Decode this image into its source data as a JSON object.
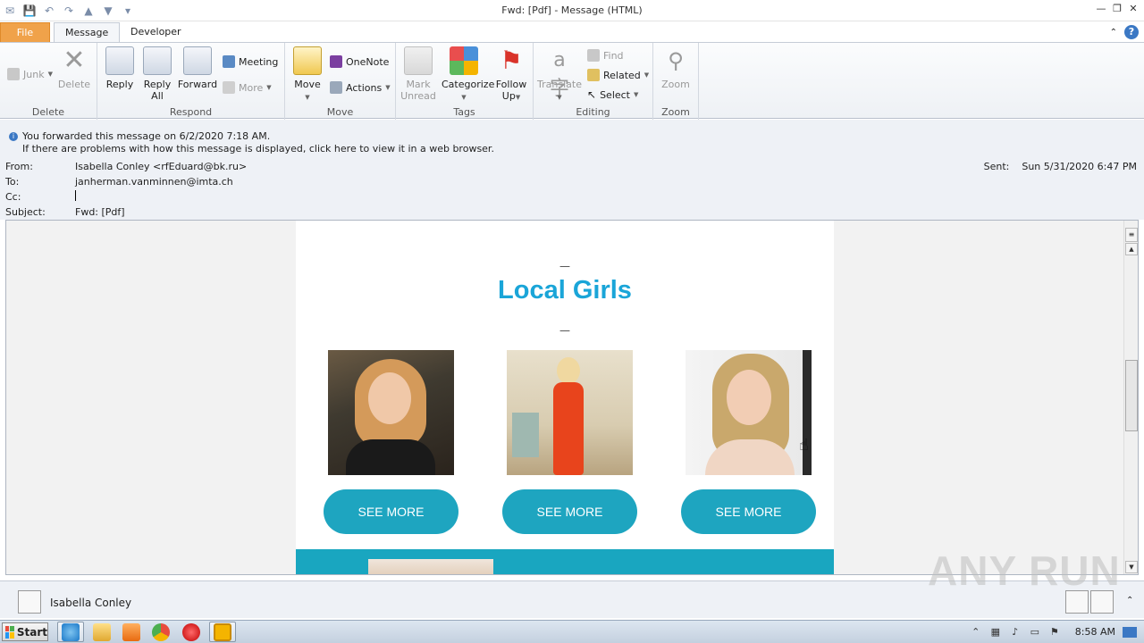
{
  "window": {
    "title": "Fwd: [Pdf]    - Message (HTML)"
  },
  "tabs": {
    "file": "File",
    "message": "Message",
    "developer": "Developer"
  },
  "ribbon": {
    "delete_group": {
      "label": "Delete",
      "junk": "Junk",
      "delete": "Delete"
    },
    "respond_group": {
      "label": "Respond",
      "reply": "Reply",
      "reply_all_1": "Reply",
      "reply_all_2": "All",
      "forward": "Forward",
      "meeting": "Meeting",
      "more": "More"
    },
    "move_group": {
      "label": "Move",
      "move": "Move",
      "onenote": "OneNote",
      "actions": "Actions"
    },
    "tags_group": {
      "label": "Tags",
      "mark_unread_1": "Mark",
      "mark_unread_2": "Unread",
      "categorize": "Categorize",
      "follow_up_1": "Follow",
      "follow_up_2": "Up"
    },
    "editing_group": {
      "label": "Editing",
      "translate": "Translate",
      "find": "Find",
      "related": "Related",
      "select": "Select"
    },
    "zoom_group": {
      "label": "Zoom",
      "zoom": "Zoom"
    }
  },
  "info": {
    "forwarded": "You forwarded this message on 6/2/2020 7:18 AM.",
    "problems": "If there are problems with how this message is displayed, click here to view it in a web browser."
  },
  "header": {
    "from_label": "From:",
    "from": "Isabella Conley <rfEduard@bk.ru>",
    "to_label": "To:",
    "to": "janherman.vanminnen@imta.ch",
    "cc_label": "Cc:",
    "cc": "",
    "subject_label": "Subject:",
    "subject": "Fwd: [Pdf]",
    "sent_label": "Sent:",
    "sent": "Sun 5/31/2020 6:47 PM"
  },
  "email": {
    "dash": "—",
    "heading": "Local Girls",
    "cards": [
      {
        "button": "SEE MORE"
      },
      {
        "button": "SEE MORE"
      },
      {
        "button": "SEE MORE"
      }
    ]
  },
  "people_pane": {
    "name": "Isabella Conley"
  },
  "watermark": "ANY RUN",
  "taskbar": {
    "start": "Start",
    "clock": "8:58 AM"
  },
  "colors": {
    "heading": "#1aa5d8",
    "button": "#1ea5c0",
    "band": "#19a6c0",
    "file_tab": "#f0a24a"
  }
}
